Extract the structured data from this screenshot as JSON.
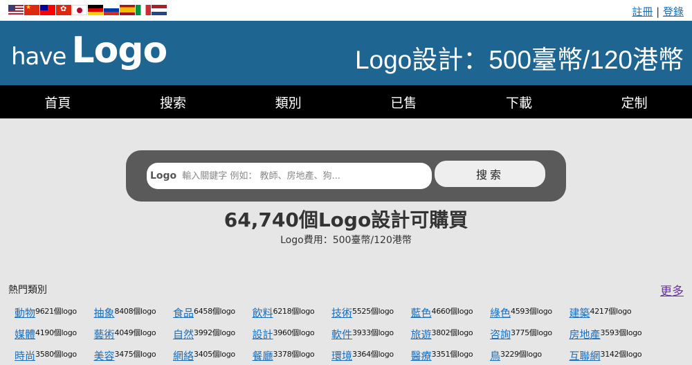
{
  "flags": [
    {
      "name": "us-flag-icon",
      "cls": "f-us"
    },
    {
      "name": "cn-flag-icon",
      "cls": "f-cn"
    },
    {
      "name": "tw-flag-icon",
      "cls": "f-tw"
    },
    {
      "name": "hk-flag-icon",
      "cls": "f-hk"
    },
    {
      "name": "jp-flag-icon",
      "cls": "f-jp"
    },
    {
      "name": "de-flag-icon",
      "cls": "f-de"
    },
    {
      "name": "ru-flag-icon",
      "cls": "f-ru"
    },
    {
      "name": "es-flag-icon",
      "cls": "f-es"
    },
    {
      "name": "it-flag-icon",
      "cls": "f-it"
    },
    {
      "name": "nl-flag-icon",
      "cls": "f-nl"
    }
  ],
  "auth": {
    "register": "註冊",
    "separator": "|",
    "login": "登錄"
  },
  "header": {
    "logo_have": "have",
    "logo_mark": "Logo",
    "title": "Logo設計：500臺幣/120港幣"
  },
  "nav": [
    "首頁",
    "搜索",
    "類別",
    "已售",
    "下載",
    "定制"
  ],
  "search": {
    "mini_logo": "Logo",
    "placeholder": "輸入關鍵字 例如： 教師、房地產、狗...",
    "value": "",
    "button": "搜索"
  },
  "count_line": "64,740個Logo設計可購買",
  "price_line": "Logo費用：500臺幣/120港幣",
  "popular": {
    "title": "熱門類別",
    "more": "更多",
    "categories": [
      {
        "label": "動物",
        "count": "9621個logo"
      },
      {
        "label": "抽象",
        "count": "8408個logo"
      },
      {
        "label": "食品",
        "count": "6458個logo"
      },
      {
        "label": "飲料",
        "count": "6218個logo"
      },
      {
        "label": "技術",
        "count": "5525個logo"
      },
      {
        "label": "藍色",
        "count": "4660個logo"
      },
      {
        "label": "綠色",
        "count": "4593個logo"
      },
      {
        "label": "建築",
        "count": "4217個logo"
      },
      {
        "label": "媒體",
        "count": "4190個logo"
      },
      {
        "label": "藝術",
        "count": "4049個logo"
      },
      {
        "label": "自然",
        "count": "3992個logo"
      },
      {
        "label": "設計",
        "count": "3960個logo"
      },
      {
        "label": "軟件",
        "count": "3933個logo"
      },
      {
        "label": "旅遊",
        "count": "3802個logo"
      },
      {
        "label": "咨詢",
        "count": "3775個logo"
      },
      {
        "label": "房地產",
        "count": "3593個logo"
      },
      {
        "label": "時尚",
        "count": "3580個logo"
      },
      {
        "label": "美容",
        "count": "3475個logo"
      },
      {
        "label": "網絡",
        "count": "3405個logo"
      },
      {
        "label": "餐廳",
        "count": "3378個logo"
      },
      {
        "label": "環境",
        "count": "3364個logo"
      },
      {
        "label": "醫療",
        "count": "3351個logo"
      },
      {
        "label": "鳥",
        "count": "3229個logo"
      },
      {
        "label": "互聯網",
        "count": "3142個logo"
      }
    ]
  }
}
